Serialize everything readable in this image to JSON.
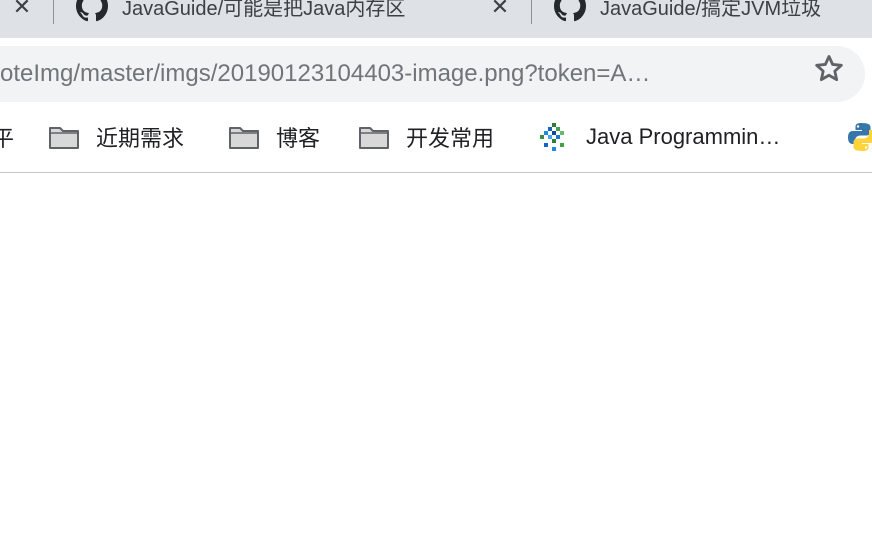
{
  "tabs": [
    {
      "title": "JavaGuide/可能是把Java内存区",
      "icon": "github-icon"
    },
    {
      "title": "JavaGuide/搞定JVM垃圾",
      "icon": "github-icon"
    }
  ],
  "omnibox": {
    "url": "oteImg/master/imgs/20190123104403-image.png?token=A…",
    "star_icon": "star-outline-icon"
  },
  "bookmarks": [
    {
      "label": "平",
      "icon": "none"
    },
    {
      "label": "近期需求",
      "icon": "folder-icon"
    },
    {
      "label": "博客",
      "icon": "folder-icon"
    },
    {
      "label": "开发常用",
      "icon": "folder-icon"
    },
    {
      "label": "Java Programmin…",
      "icon": "java-programming-icon"
    },
    {
      "label": "",
      "icon": "python-icon"
    }
  ],
  "colors": {
    "tabstrip_bg": "#dee1e6",
    "omnibox_bg": "#f1f3f4",
    "url_text": "#70757a",
    "bookmark_text": "#202124"
  }
}
